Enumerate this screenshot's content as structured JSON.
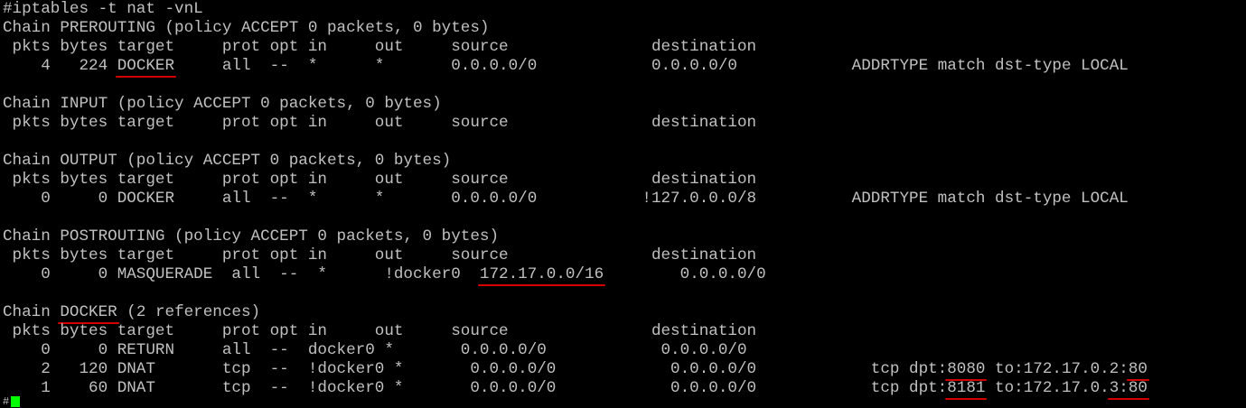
{
  "terminal": {
    "command": "#iptables -t nat -vnL",
    "chains": [
      {
        "title": "Chain PREROUTING (policy ACCEPT 0 packets, 0 bytes)",
        "header": " pkts bytes target     prot opt in     out     source               destination",
        "rules": [
          {
            "p1": "    4   224 ",
            "u1": "DOCKER",
            "p2": "     all  --  *      *       0.0.0.0/0            0.0.0.0/0            ADDRTYPE match dst-type LOCAL"
          }
        ]
      },
      {
        "title": "Chain INPUT (policy ACCEPT 0 packets, 0 bytes)",
        "header": " pkts bytes target     prot opt in     out     source               destination",
        "rules": []
      },
      {
        "title": "Chain OUTPUT (policy ACCEPT 0 packets, 0 bytes)",
        "header": " pkts bytes target     prot opt in     out     source               destination",
        "rules": [
          {
            "p1": "    0     0 DOCKER     all  --  *      *       0.0.0.0/0           !127.0.0.0/8          ADDRTYPE match dst-type LOCAL"
          }
        ]
      },
      {
        "title": "Chain POSTROUTING (policy ACCEPT 0 packets, 0 bytes)",
        "header": " pkts bytes target     prot opt in     out     source               destination",
        "rules": [
          {
            "p1": "    0     0 MASQUERADE  all  --  *      !docker0  ",
            "u1": "172.17.0.0/16",
            "p2": "        0.0.0.0/0"
          }
        ]
      },
      {
        "title_pre": "Chain ",
        "title_ul": "DOCKER",
        "title_post": " (2 references)",
        "header": " pkts bytes target     prot opt in     out     source               destination",
        "rules": [
          {
            "p1": "    0     0 RETURN     all  --  docker0 *       0.0.0.0/0            0.0.0.0/0"
          },
          {
            "p1": "    2   120 DNAT       tcp  --  !docker0 *       0.0.0.0/0            0.0.0.0/0            tcp dpt:",
            "u1": "8080",
            "p2": " to:172.17.0.2:",
            "u2": "80"
          },
          {
            "p1": "    1    60 DNAT       tcp  --  !docker0 *       0.0.0.0/0            0.0.0.0/0            tcp dpt:",
            "u1": "8181",
            "p2": " to:172.17.0.",
            "u2": "3:80"
          }
        ]
      }
    ],
    "prompt": "#"
  }
}
